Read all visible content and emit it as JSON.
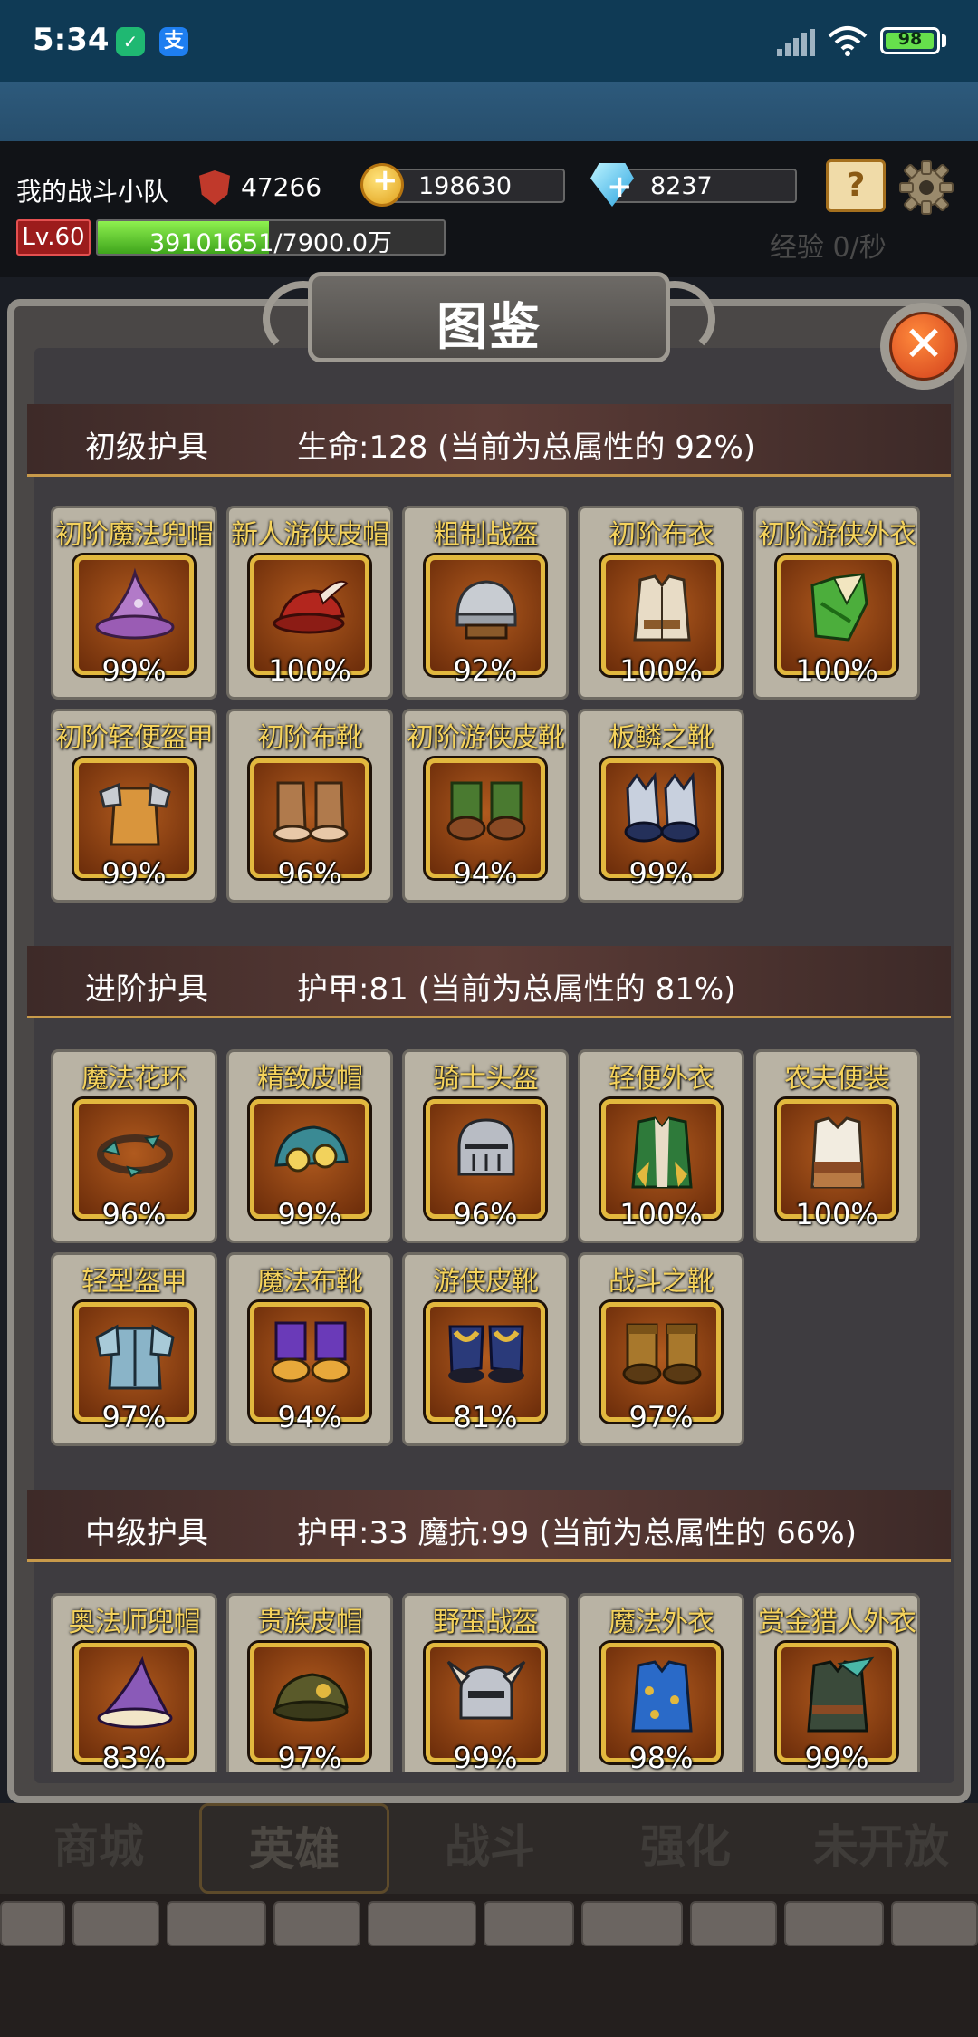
{
  "status_bar": {
    "time": "5:34",
    "battery": "98",
    "battery_level": 0.98
  },
  "header": {
    "team_name": "我的战斗小队",
    "power": "47266",
    "gold": "198630",
    "gems": "8237",
    "level": "Lv.60",
    "exp_current": "39101651",
    "exp_total": "/7900.0万",
    "exp_fraction": 0.495,
    "exp_rate": "经验 0/秒"
  },
  "dialog": {
    "title": "图鉴",
    "close_symbol": "✕"
  },
  "sections": [
    {
      "name": "初级护具",
      "stat": "生命:128 (当前为总属性的 92%)",
      "items": [
        {
          "name": "初阶魔法兜帽",
          "pct": "99%",
          "icon": "wizard-hat-icon"
        },
        {
          "name": "新人游侠皮帽",
          "pct": "100%",
          "icon": "feathered-cap-icon"
        },
        {
          "name": "粗制战盔",
          "pct": "92%",
          "icon": "steel-helmet-icon"
        },
        {
          "name": "初阶布衣",
          "pct": "100%",
          "icon": "cloth-vest-icon"
        },
        {
          "name": "初阶游侠外衣",
          "pct": "100%",
          "icon": "ranger-coat-icon"
        },
        {
          "name": "初阶轻便盔甲",
          "pct": "99%",
          "icon": "light-armor-icon"
        },
        {
          "name": "初阶布靴",
          "pct": "96%",
          "icon": "cloth-boots-icon"
        },
        {
          "name": "初阶游侠皮靴",
          "pct": "94%",
          "icon": "ranger-boots-icon"
        },
        {
          "name": "板鳞之靴",
          "pct": "99%",
          "icon": "scale-boots-icon"
        }
      ]
    },
    {
      "name": "进阶护具",
      "stat": "护甲:81 (当前为总属性的 81%)",
      "items": [
        {
          "name": "魔法花环",
          "pct": "96%",
          "icon": "wreath-icon"
        },
        {
          "name": "精致皮帽",
          "pct": "99%",
          "icon": "goggles-cap-icon"
        },
        {
          "name": "骑士头盔",
          "pct": "96%",
          "icon": "knight-helmet-icon"
        },
        {
          "name": "轻便外衣",
          "pct": "100%",
          "icon": "light-coat-icon"
        },
        {
          "name": "农夫便装",
          "pct": "100%",
          "icon": "farmer-shirt-icon"
        },
        {
          "name": "轻型盔甲",
          "pct": "97%",
          "icon": "plate-armor-icon"
        },
        {
          "name": "魔法布靴",
          "pct": "94%",
          "icon": "magic-boots-icon"
        },
        {
          "name": "游侠皮靴",
          "pct": "81%",
          "icon": "leather-boots-icon"
        },
        {
          "name": "战斗之靴",
          "pct": "97%",
          "icon": "battle-boots-icon"
        }
      ]
    },
    {
      "name": "中级护具",
      "stat": "护甲:33   魔抗:99 (当前为总属性的 66%)",
      "items": [
        {
          "name": "奥法师兜帽",
          "pct": "83%",
          "icon": "arcane-hood-icon"
        },
        {
          "name": "贵族皮帽",
          "pct": "97%",
          "icon": "noble-cap-icon"
        },
        {
          "name": "野蛮战盔",
          "pct": "99%",
          "icon": "horned-helmet-icon"
        },
        {
          "name": "魔法外衣",
          "pct": "98%",
          "icon": "magic-coat-icon"
        },
        {
          "name": "赏金猎人外衣",
          "pct": "99%",
          "icon": "hunter-coat-icon"
        }
      ]
    }
  ],
  "bottom_nav": [
    {
      "label": "商城"
    },
    {
      "label": "英雄"
    },
    {
      "label": "战斗"
    },
    {
      "label": "强化"
    },
    {
      "label": "未开放"
    }
  ],
  "colors": {
    "card_title": "#f4d25c",
    "slot_border": "#e2b83e",
    "exp_bar": "#5fcf2c",
    "level_badge": "#9c1c1c"
  }
}
